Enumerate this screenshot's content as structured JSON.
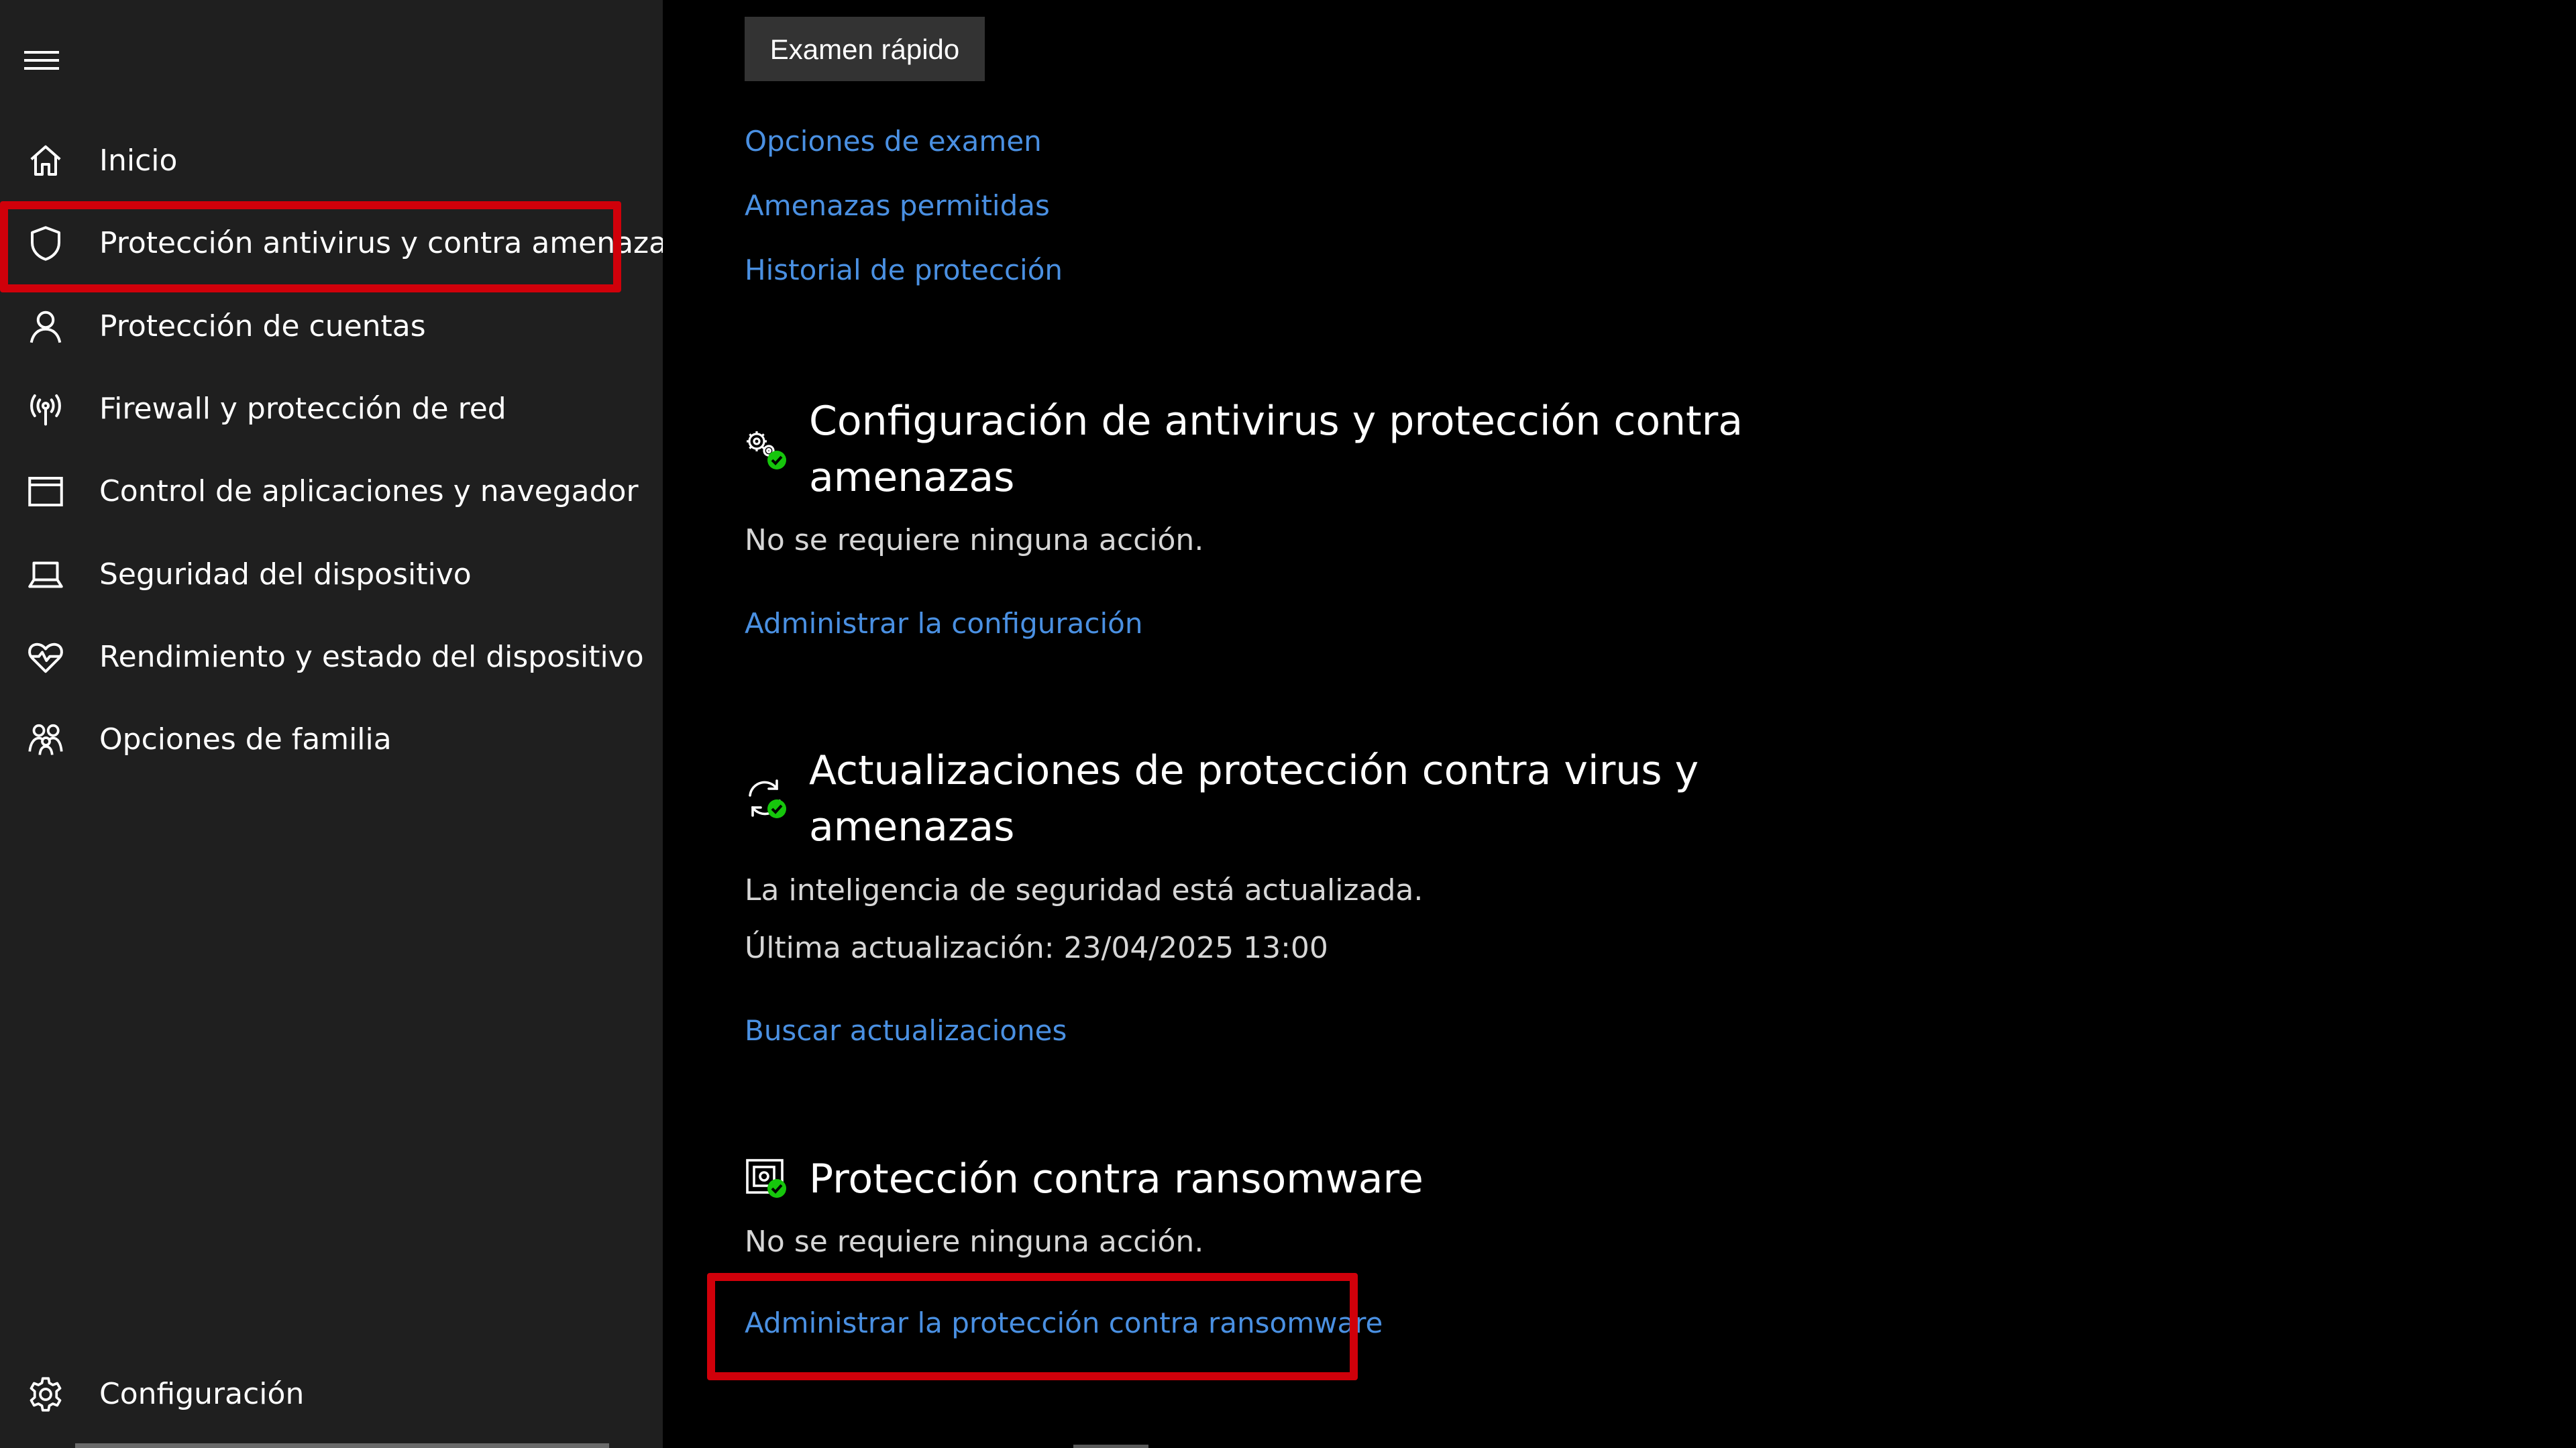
{
  "sidebar": {
    "items": [
      {
        "label": "Inicio",
        "icon": "home-icon"
      },
      {
        "label": "Protección antivirus y contra amenazas",
        "icon": "shield-icon"
      },
      {
        "label": "Protección de cuentas",
        "icon": "person-icon"
      },
      {
        "label": "Firewall y protección de red",
        "icon": "antenna-icon"
      },
      {
        "label": "Control de aplicaciones y navegador",
        "icon": "browser-window-icon"
      },
      {
        "label": "Seguridad del dispositivo",
        "icon": "laptop-icon"
      },
      {
        "label": "Rendimiento y estado del dispositivo",
        "icon": "heart-icon"
      },
      {
        "label": "Opciones de familia",
        "icon": "family-icon"
      }
    ],
    "settings_label": "Configuración"
  },
  "main": {
    "quick_scan_label": "Examen rápido",
    "links": {
      "scan_options": "Opciones de examen",
      "allowed_threats": "Amenazas permitidas",
      "protection_history": "Historial de protección"
    },
    "settings_section": {
      "title": "Configuración de antivirus y protección contra amenazas",
      "status": "No se requiere ninguna acción.",
      "link": "Administrar la configuración"
    },
    "updates_section": {
      "title": "Actualizaciones de protección contra virus y amenazas",
      "status": "La inteligencia de seguridad está actualizada.",
      "last_update": "Última actualización: 23/04/2025 13:00",
      "link": "Buscar actualizaciones"
    },
    "ransomware_section": {
      "title": "Protección contra ransomware",
      "status": "No se requiere ninguna acción.",
      "link": "Administrar la protección contra ransomware"
    }
  },
  "colors": {
    "sidebar_bg": "#1f1f1f",
    "main_bg": "#000000",
    "link": "#4a90e2",
    "highlight": "#d0000a",
    "check_green": "#16c60c"
  }
}
